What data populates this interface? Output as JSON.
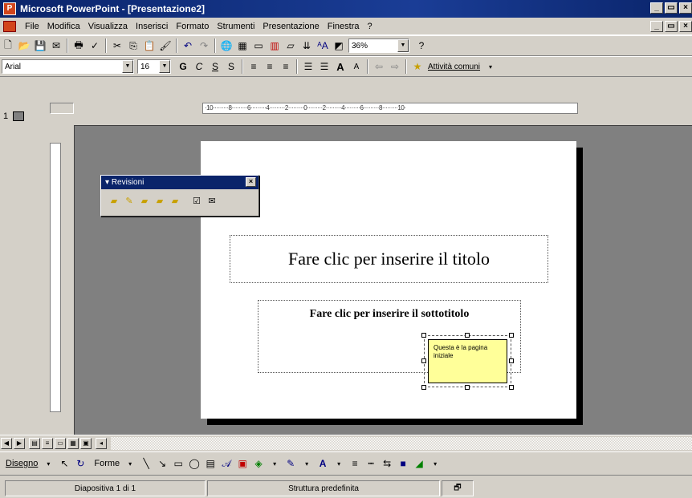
{
  "window": {
    "title": "Microsoft PowerPoint - [Presentazione2]",
    "app_icon": "powerpoint-icon",
    "buttons": [
      "_",
      "□",
      "×"
    ]
  },
  "menubar": {
    "items": [
      "File",
      "Modifica",
      "Visualizza",
      "Inserisci",
      "Formato",
      "Strumenti",
      "Presentazione",
      "Finestra",
      "?"
    ]
  },
  "toolbar1": {
    "zoom": "36%"
  },
  "toolbar2": {
    "font": "Arial",
    "size": "16",
    "bold": "G",
    "italic": "C",
    "underline": "S",
    "shadow": "S",
    "common_tasks": "Attività comuni"
  },
  "outline": {
    "slide_number": "1"
  },
  "ruler": {
    "horizontal": "·10·········8·········6·········4·········2·········0·········2·········4·········6·········8·········10·"
  },
  "slide": {
    "title_placeholder": "Fare clic per inserire il titolo",
    "subtitle_placeholder": "Fare clic per inserire il sottotitolo"
  },
  "comment": {
    "text": "Questa è la pagina iniziale"
  },
  "revisioni": {
    "title": "Revisioni",
    "close": "×"
  },
  "drawbar": {
    "draw": "Disegno",
    "shapes": "Forme"
  },
  "statusbar": {
    "slide": "Diapositiva 1 di 1",
    "design": "Struttura predefinita"
  }
}
